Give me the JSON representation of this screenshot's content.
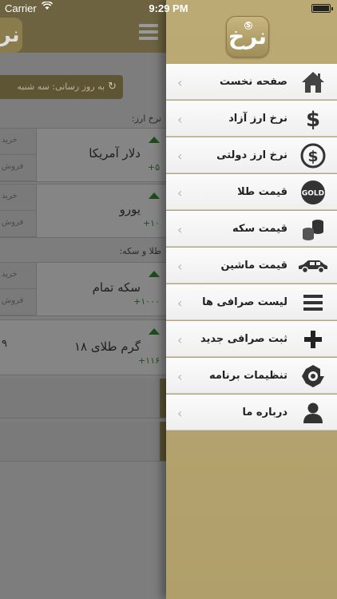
{
  "status_bar": {
    "carrier": "Carrier",
    "time": "9:29 PM"
  },
  "main": {
    "logo_text": "نرخ",
    "refresh_text": "به روز رسانی: سه شنبه",
    "currency_section_label": "نرخ ارز:",
    "gold_section_label": "طلا و سکه:",
    "cards": [
      {
        "name": "دلار آمریکا",
        "change": "+۵",
        "buy_label": "خرید",
        "sell_label": "فروش"
      },
      {
        "name": "یورو",
        "change": "+۱۰",
        "buy_label": "خرید",
        "sell_label": "فروش"
      },
      {
        "name": "سکه تمام",
        "change": "+۱۰۰۰",
        "buy_label": "خرید",
        "sell_label": "فروش"
      },
      {
        "name": "گرم طلای ۱۸",
        "change": "+۱۱۶",
        "value": "۹"
      }
    ]
  },
  "drawer": {
    "logo_text": "نرخ",
    "logo_coin": "$",
    "items": [
      {
        "label": "صفحه نخست",
        "icon": "home-icon"
      },
      {
        "label": "نرخ ارز آزاد",
        "icon": "dollar-icon"
      },
      {
        "label": "نرخ ارز دولتی",
        "icon": "dollar-circle-icon"
      },
      {
        "label": "قیمت طلا",
        "icon": "gold-icon",
        "icon_text": "GOLD"
      },
      {
        "label": "قیمت سکه",
        "icon": "coins-icon"
      },
      {
        "label": "قیمت ماشین",
        "icon": "car-icon"
      },
      {
        "label": "لیست صرافی ها",
        "icon": "list-icon"
      },
      {
        "label": "ثبت صرافی جدید",
        "icon": "plus-icon"
      },
      {
        "label": "تنظیمات برنامه",
        "icon": "gear-icon"
      },
      {
        "label": "درباره ما",
        "icon": "user-icon"
      }
    ],
    "chevron": "‹"
  }
}
